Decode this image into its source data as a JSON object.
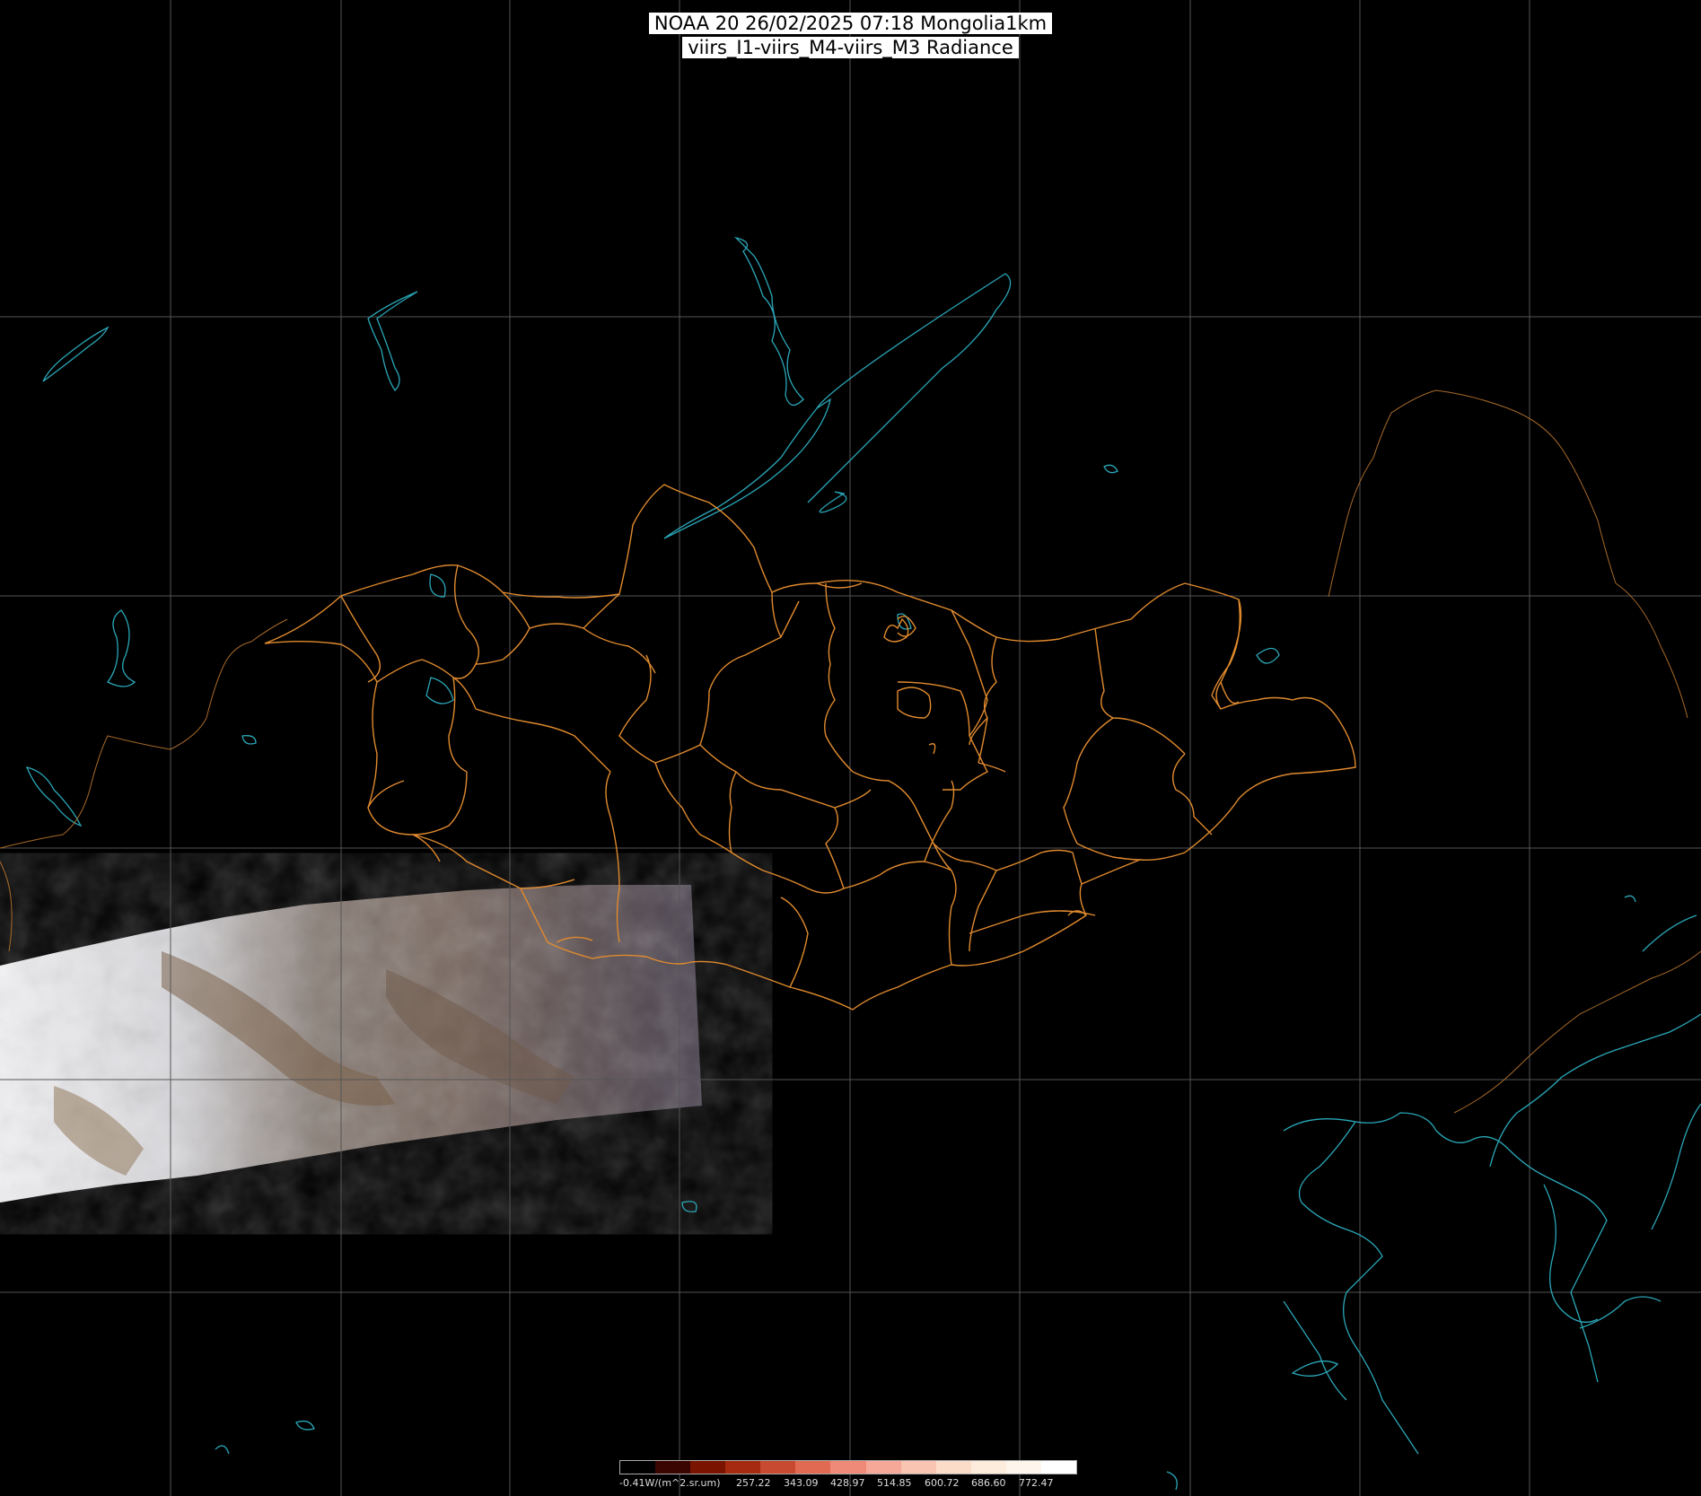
{
  "title": {
    "line1": "NOAA 20 26/02/2025 07:18 Mongolia1km",
    "line2": "viirs_I1-viirs_M4-viirs_M3 Radiance"
  },
  "legend": {
    "labels": [
      "-0.41W/(m^2.sr.um)",
      "257.22",
      "343.09",
      "428.97",
      "514.85",
      "600.72",
      "686.60",
      "772.47"
    ],
    "colors": [
      "#000000",
      "#3a0500",
      "#7a1400",
      "#a52a10",
      "#c84a30",
      "#e06a52",
      "#f08a78",
      "#f6a898",
      "#f9c4b2",
      "#fbdcc8",
      "#fdebdc",
      "#fef5ec",
      "#ffffff"
    ]
  },
  "colors": {
    "background": "#000000",
    "grid": "#555555",
    "border": "#e08a2e",
    "coast": "#2aa7b8",
    "country": "#a86a2a"
  }
}
